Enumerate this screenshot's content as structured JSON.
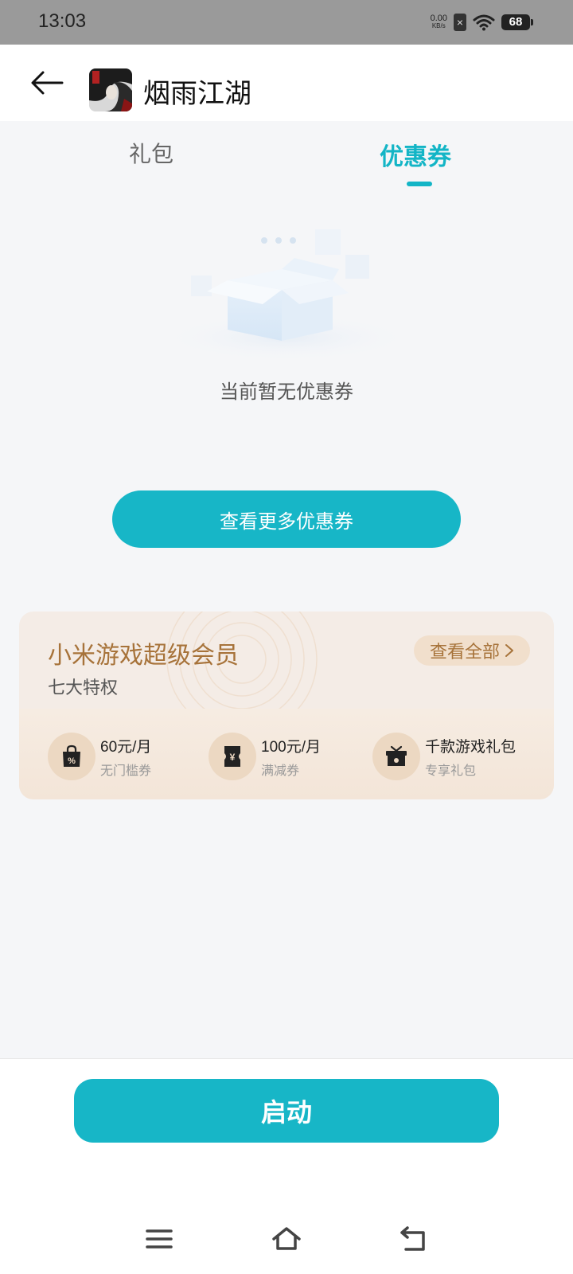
{
  "status_bar": {
    "time": "13:03",
    "net_speed_value": "0.00",
    "net_speed_unit": "KB/s",
    "battery": "68",
    "icons": [
      "sim-off-icon",
      "wifi-icon",
      "battery-icon"
    ]
  },
  "header": {
    "back_icon": "back-arrow-icon",
    "game_title": "烟雨江湖"
  },
  "tabs": {
    "items": [
      {
        "label": "礼包",
        "active": false
      },
      {
        "label": "优惠券",
        "active": true
      }
    ],
    "accent_color": "#13b5c6"
  },
  "empty_state": {
    "message": "当前暂无优惠券"
  },
  "more_button": {
    "label": "查看更多优惠券"
  },
  "vip_card": {
    "title": "小米游戏超级会员",
    "subtitle": "七大特权",
    "view_all_label": "查看全部",
    "perks": [
      {
        "icon": "discount-bag-icon",
        "main": "60元/月",
        "sub": "无门槛券"
      },
      {
        "icon": "yuan-ticket-icon",
        "main": "100元/月",
        "sub": "满减券"
      },
      {
        "icon": "gift-box-icon",
        "main": "千款游戏礼包",
        "sub": "专享礼包"
      }
    ],
    "title_color": "#a7733a"
  },
  "bottom": {
    "launch_label": "启动",
    "nav_icons": [
      "menu-icon",
      "home-icon",
      "back-nav-icon"
    ]
  }
}
